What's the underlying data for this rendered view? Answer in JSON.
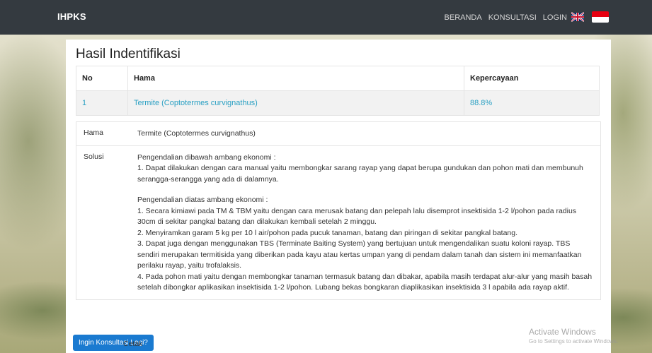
{
  "navbar": {
    "brand": "IHPKS",
    "links": [
      "BERANDA",
      "KONSULTASI",
      "LOGIN"
    ],
    "icons": [
      "uk-flag-icon",
      "indonesia-flag-icon"
    ]
  },
  "page_title": "Hasil Indentifikasi",
  "results_table": {
    "headers": [
      "No",
      "Hama",
      "Kepercayaan"
    ],
    "rows": [
      {
        "no": "1",
        "hama": "Termite (Coptotermes curvignathus)",
        "confidence": "88.8%"
      }
    ]
  },
  "detail": {
    "hama_label": "Hama",
    "hama_value": "Termite (Coptotermes curvignathus)",
    "solusi_label": "Solusi",
    "solusi_lines": [
      "Pengendalian dibawah ambang ekonomi :",
      "1. Dapat dilakukan dengan cara manual yaitu membongkar sarang rayap yang dapat berupa gundukan dan pohon mati dan membunuh serangga-serangga yang ada di dalamnya.",
      "",
      "Pengendalian diatas ambang ekonomi :",
      "1. Secara kimiawi pada TM & TBM yaitu dengan cara merusak batang dan pelepah lalu disemprot insektisida 1-2 l/pohon pada radius 30cm di sekitar pangkal batang dan dilakukan kembali setelah 2 minggu.",
      "2. Menyiramkan garam 5 kg per 10 l air/pohon pada pucuk tanaman, batang dan piringan di sekitar pangkal batang.",
      "3. Dapat juga dengan menggunakan TBS (Terminate Baiting System) yang bertujuan untuk mengendalikan suatu koloni rayap. TBS sendiri merupakan termitisida yang diberikan pada kayu atau kertas umpan yang di pendam dalam tanah dan sistem ini memanfaatkan perilaku rayap, yaitu trofalaksis.",
      "4. Pada pohon mati yaitu dengan membongkar tanaman termasuk batang dan dibakar, apabila masih terdapat alur-alur yang masih basah setelah dibongkar aplikasikan insektisida 1-2 l/pohon. Lubang bekas bongkaran diaplikasikan insektisida 3 l apabila ada rayap aktif."
    ]
  },
  "actions": {
    "consult_again_label": "Ingin Konsultasi Lagi?",
    "print_label": "Cetak"
  },
  "watermark": {
    "line1": "Activate Windows",
    "line2": "Go to Settings to activate Windows."
  },
  "colors": {
    "navbar": "#343a40",
    "link": "#2aa0c3",
    "button": "#1a7ad0"
  }
}
